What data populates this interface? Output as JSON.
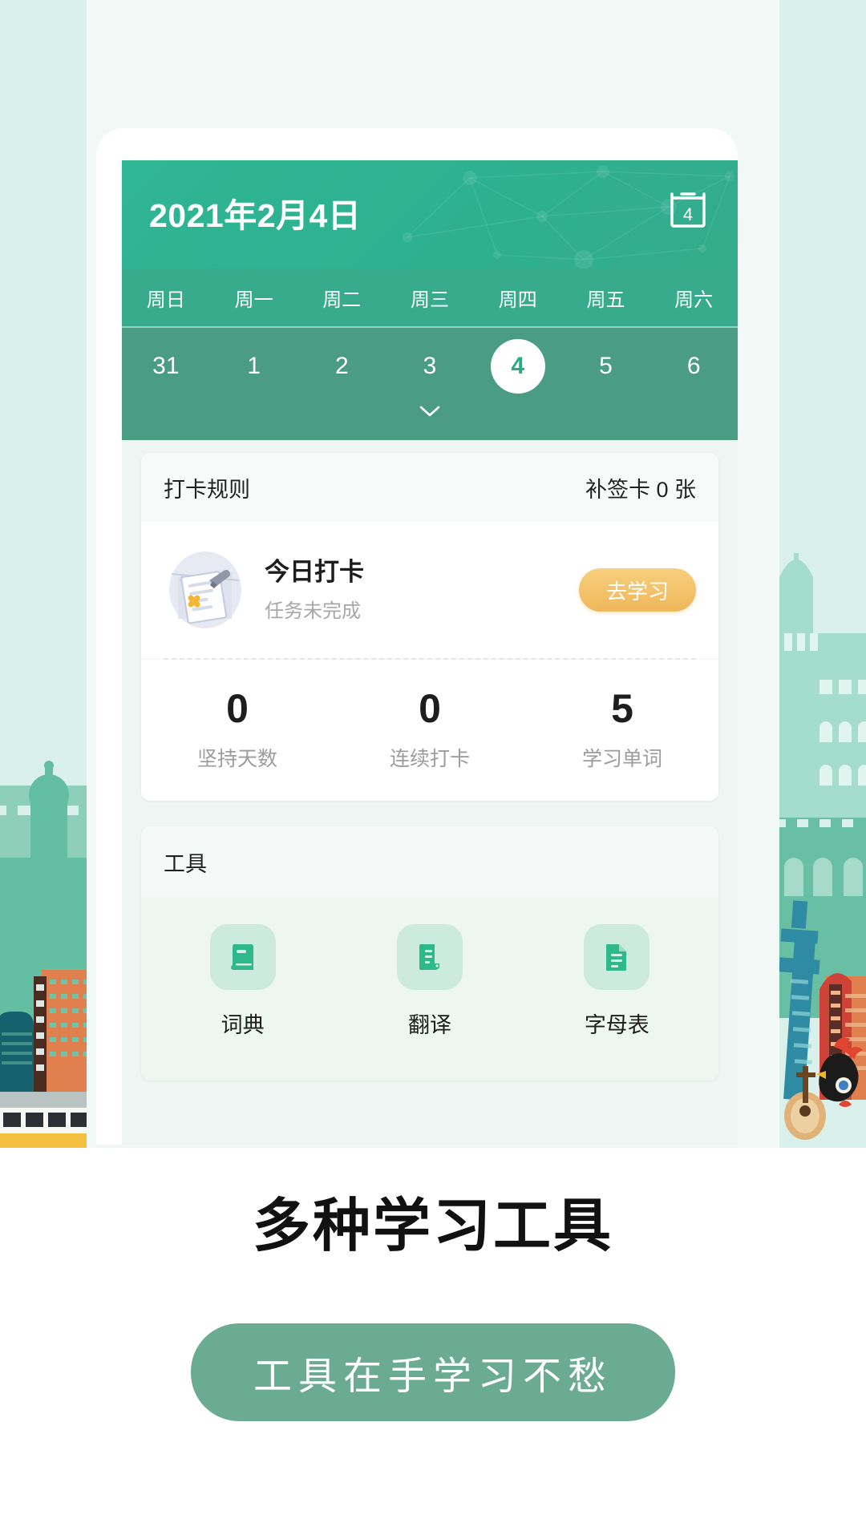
{
  "header": {
    "date_title": "2021年2月4日",
    "calendar_icon_day": "4",
    "calendar_icon": "calendar-icon",
    "weekdays": [
      "周日",
      "周一",
      "周二",
      "周三",
      "周四",
      "周五",
      "周六"
    ],
    "days": [
      "31",
      "1",
      "2",
      "3",
      "4",
      "5",
      "6"
    ],
    "selected_day": "4",
    "expand_icon": "chevron-down-icon",
    "accent_color": "#2fb694",
    "strip_color": "#4a9c82"
  },
  "checkin_card": {
    "rules_label": "打卡规则",
    "makeup_cards": "补签卡 0 张",
    "title": "今日打卡",
    "subtitle": "任务未完成",
    "action_label": "去学习",
    "action_color": "#efb75c",
    "illustration_icon": "checklist-illustration",
    "stats": [
      {
        "value": "0",
        "label": "坚持天数"
      },
      {
        "value": "0",
        "label": "连续打卡"
      },
      {
        "value": "5",
        "label": "学习单词"
      }
    ]
  },
  "tools_card": {
    "title": "工具",
    "items": [
      {
        "label": "词典",
        "icon": "book-icon"
      },
      {
        "label": "翻译",
        "icon": "translate-document-icon"
      },
      {
        "label": "字母表",
        "icon": "document-lines-icon"
      }
    ],
    "chip_color": "#cdeade",
    "icon_color": "#2eb98c"
  },
  "caption": {
    "headline": "多种学习工具",
    "pill_text": "工具在手学习不愁",
    "pill_color": "#6bab94"
  }
}
